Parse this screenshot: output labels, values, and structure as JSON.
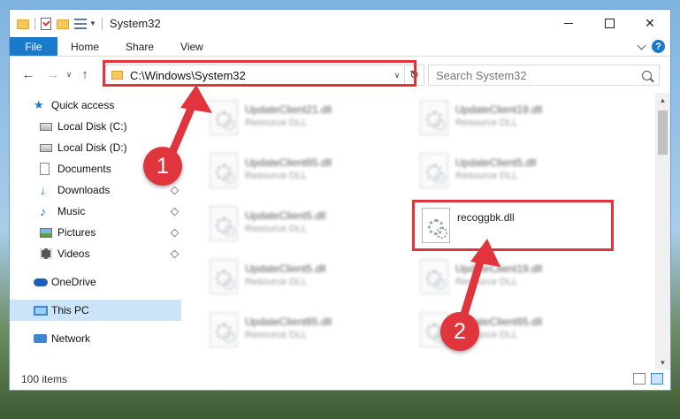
{
  "window": {
    "title": "System32",
    "controls": {
      "minimize": "",
      "maximize": "",
      "close": "✕"
    }
  },
  "ribbon": {
    "file_tab": "File",
    "tabs": [
      "Home",
      "Share",
      "View"
    ],
    "help": "?"
  },
  "nav": {
    "back": "←",
    "forward": "→",
    "recent": "∨",
    "up": "↑",
    "address": "C:\\Windows\\System32",
    "address_dropdown": "∨",
    "refresh": "↻",
    "search_placeholder": "Search System32"
  },
  "sidebar": {
    "items": [
      {
        "label": "Quick access",
        "icon": "star-icon",
        "pinned": false
      },
      {
        "label": "Local Disk (C:)",
        "icon": "drive-icon",
        "pinned": false
      },
      {
        "label": "Local Disk (D:)",
        "icon": "drive-icon",
        "pinned": false
      },
      {
        "label": "Documents",
        "icon": "documents-icon",
        "pinned": false
      },
      {
        "label": "Downloads",
        "icon": "download-icon",
        "pinned": true
      },
      {
        "label": "Music",
        "icon": "music-icon",
        "pinned": true
      },
      {
        "label": "Pictures",
        "icon": "pictures-icon",
        "pinned": true
      },
      {
        "label": "Videos",
        "icon": "videos-icon",
        "pinned": true
      },
      {
        "label": "OneDrive",
        "icon": "cloud-icon",
        "pinned": false
      },
      {
        "label": "This PC",
        "icon": "computer-icon",
        "pinned": false,
        "selected": true
      },
      {
        "label": "Network",
        "icon": "network-icon",
        "pinned": false
      }
    ]
  },
  "files": [
    {
      "name": "UpdateClient21.dll",
      "type": "Resource DLL",
      "blurred": true
    },
    {
      "name": "UpdateClient19.dll",
      "type": "Resource DLL",
      "blurred": true
    },
    {
      "name": "UpdateClient65.dll",
      "type": "Resource DLL",
      "blurred": true
    },
    {
      "name": "UpdateClient5.dll",
      "type": "Resource DLL",
      "blurred": true
    },
    {
      "name": "UpdateClient5.dll",
      "type": "Resource DLL",
      "blurred": true
    },
    {
      "name": "recoggbk.dll",
      "type": "",
      "blurred": false,
      "highlighted": true
    },
    {
      "name": "UpdateClient5.dll",
      "type": "Resource DLL",
      "blurred": true
    },
    {
      "name": "UpdateClient19.dll",
      "type": "Resource DLL",
      "blurred": true
    },
    {
      "name": "UpdateClient65.dll",
      "type": "Resource DLL",
      "blurred": true
    },
    {
      "name": "UpdateClient65.dll",
      "type": "Resource DLL",
      "blurred": true
    }
  ],
  "status": {
    "item_count": "100 items"
  },
  "annotations": {
    "step1": "1",
    "step2": "2",
    "color": "#e0353d"
  }
}
